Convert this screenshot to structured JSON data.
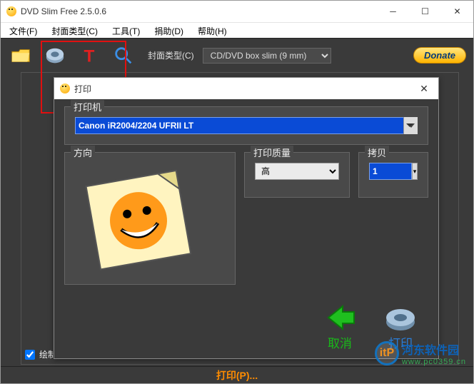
{
  "app": {
    "title": "DVD Slim Free 2.5.0.6",
    "menu": [
      "文件(F)",
      "封面类型(C)",
      "工具(T)",
      "捐助(D)",
      "帮助(H)"
    ]
  },
  "toolbar": {
    "cover_type_label": "封面类型(C)",
    "cover_type_value": "CD/DVD box slim (9 mm)",
    "donate_label": "Donate"
  },
  "workspace": {
    "draw_border_label": "绘制边缘",
    "draw_border_checked": true
  },
  "statusbar": {
    "text": "打印(P)..."
  },
  "dialog": {
    "title": "打印",
    "printer_group": "打印机",
    "printer_value": "Canon iR2004/2204 UFRII LT",
    "direction_group": "方向",
    "quality_group": "打印质量",
    "quality_value": "高",
    "copies_group": "拷贝",
    "copies_value": "1",
    "cancel_label": "取消",
    "print_label": "打印"
  },
  "watermark": {
    "name": "河东软件园",
    "url": "www.pc0359.cn",
    "logo_text": "itP"
  },
  "icons": {
    "folder": "folder-icon",
    "printer": "printer-icon",
    "text": "t-icon",
    "magnifier": "magnifier-icon"
  }
}
